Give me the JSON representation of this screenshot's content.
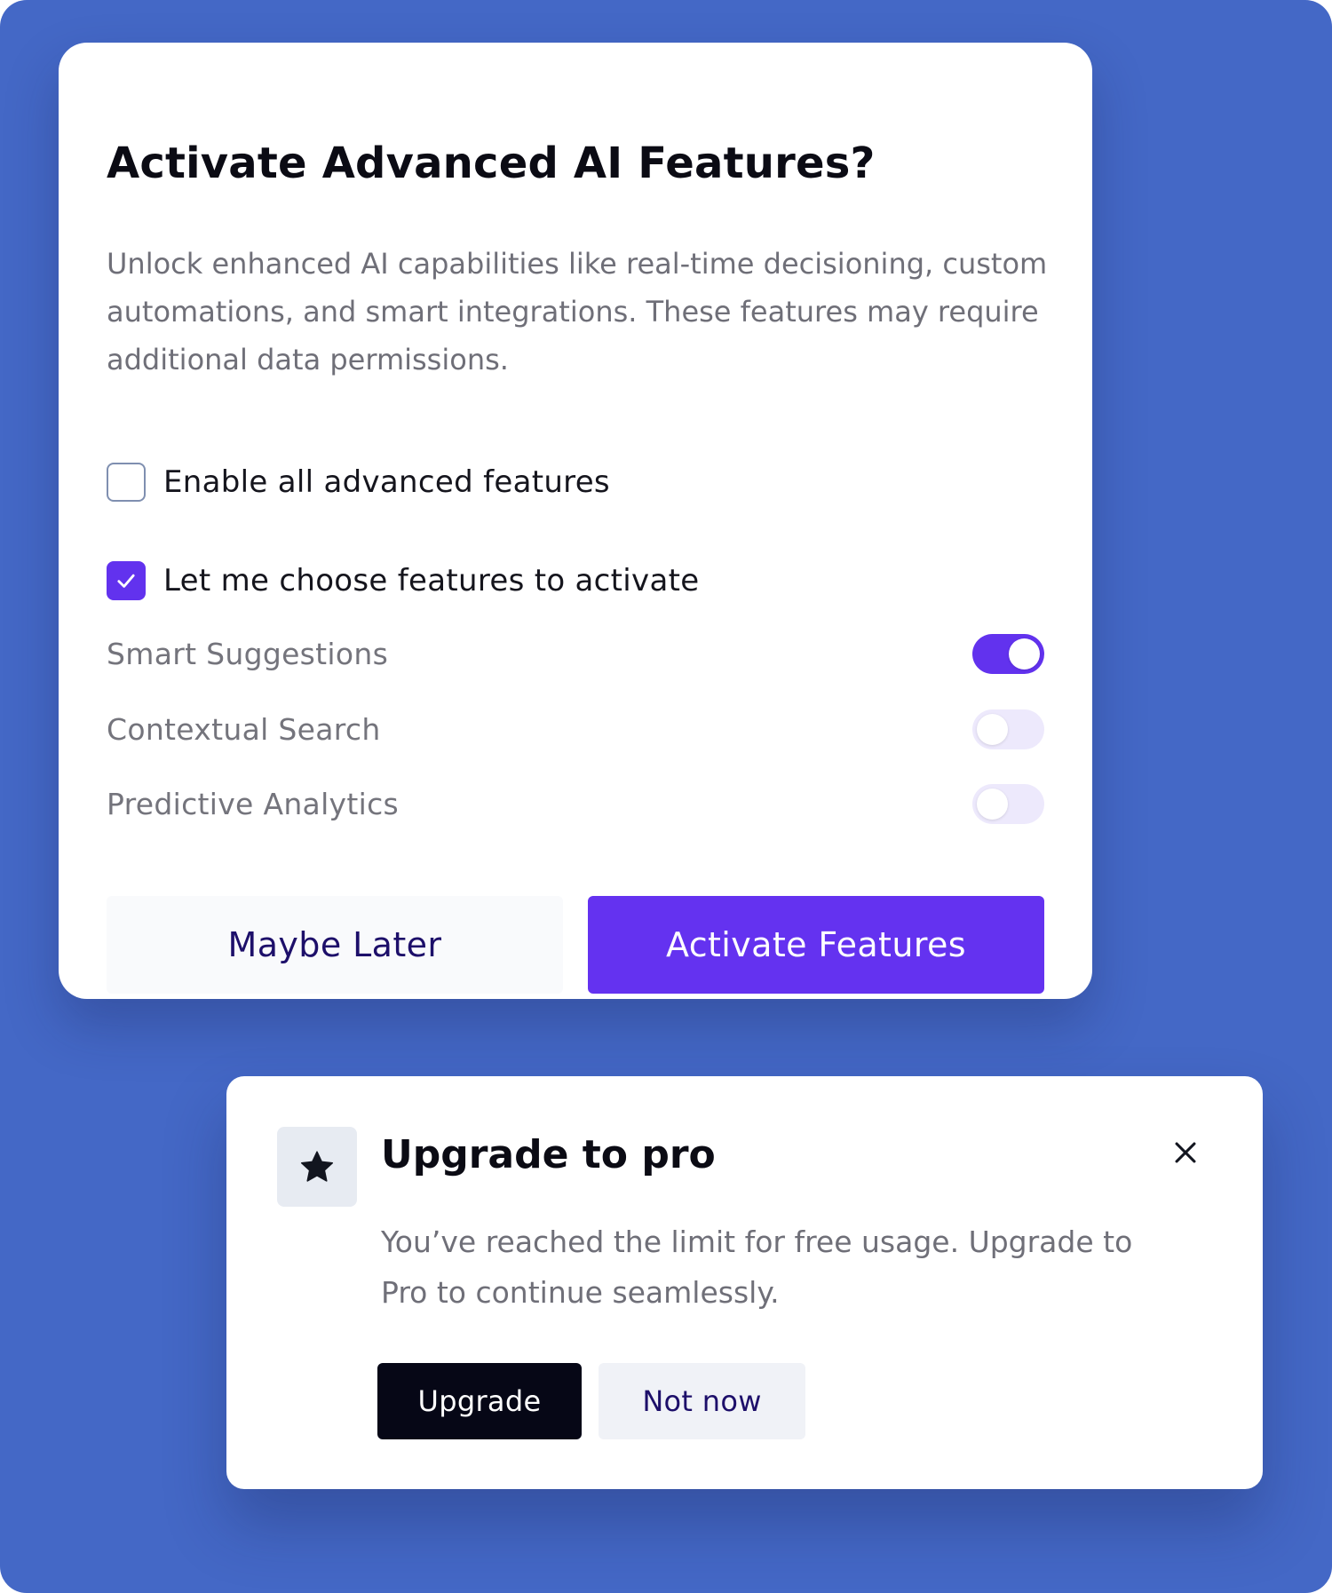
{
  "theme": {
    "background": "#4468C6",
    "accent": "#6232EE",
    "dark_button": "#060716",
    "secondary_text": "#6F6F78"
  },
  "dialog": {
    "title": "Activate Advanced AI Features?",
    "description": "Unlock enhanced AI capabilities like real-time decisioning, custom automations, and smart integrations. These features may require additional data permissions.",
    "options": [
      {
        "label": "Enable all advanced features",
        "checked": false
      },
      {
        "label": "Let me choose features to activate",
        "checked": true
      }
    ],
    "features": [
      {
        "label": "Smart Suggestions",
        "enabled": true
      },
      {
        "label": "Contextual Search",
        "enabled": false
      },
      {
        "label": "Predictive Analytics",
        "enabled": false
      }
    ],
    "secondary_button": "Maybe Later",
    "primary_button": "Activate Features"
  },
  "toast": {
    "icon": "star-icon",
    "title": "Upgrade to pro",
    "close_icon": "close-icon",
    "description": "You’ve reached the limit for free usage. Upgrade to Pro to continue seamlessly.",
    "primary_button": "Upgrade",
    "secondary_button": "Not now"
  }
}
